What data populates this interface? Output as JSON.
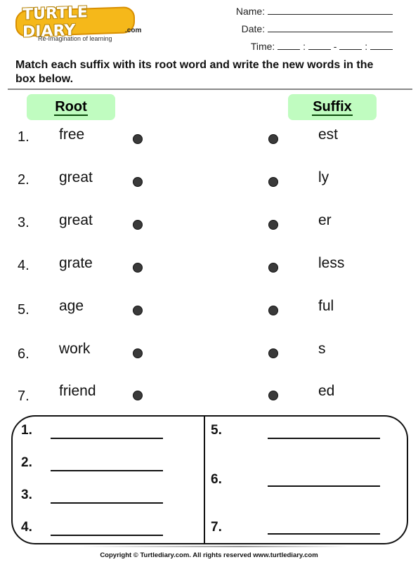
{
  "logo": {
    "brand": "TURTLE DIARY",
    "domain_suffix": ".com",
    "tagline": "Re-Imagination of learning"
  },
  "header_fields": {
    "name_label": "Name:",
    "date_label": "Date:",
    "time_label": "Time:",
    "time_separators": [
      ":",
      "-",
      ":"
    ]
  },
  "instructions": "Match each suffix with its root word and write the new words in the box below.",
  "columns": {
    "root_header": "Root",
    "suffix_header": "Suffix"
  },
  "rows": [
    {
      "number": "1.",
      "root": "free",
      "suffix": "est"
    },
    {
      "number": "2.",
      "root": "great",
      "suffix": "ly"
    },
    {
      "number": "3.",
      "root": "great",
      "suffix": "er"
    },
    {
      "number": "4.",
      "root": "grate",
      "suffix": "less"
    },
    {
      "number": "5.",
      "root": "age",
      "suffix": "ful"
    },
    {
      "number": "6.",
      "root": "work",
      "suffix": "s"
    },
    {
      "number": "7.",
      "root": "friend",
      "suffix": "ed"
    }
  ],
  "answer_box": {
    "left_numbers": [
      "1.",
      "2.",
      "3.",
      "4."
    ],
    "right_numbers": [
      "5.",
      "6.",
      "7."
    ]
  },
  "footer": "Copyright © Turtlediary.com. All rights reserved  www.turtlediary.com",
  "colors": {
    "header_tag_bg": "#c0fcc0",
    "logo_orange": "#f5b81a",
    "dot": "#3a3a3a"
  }
}
